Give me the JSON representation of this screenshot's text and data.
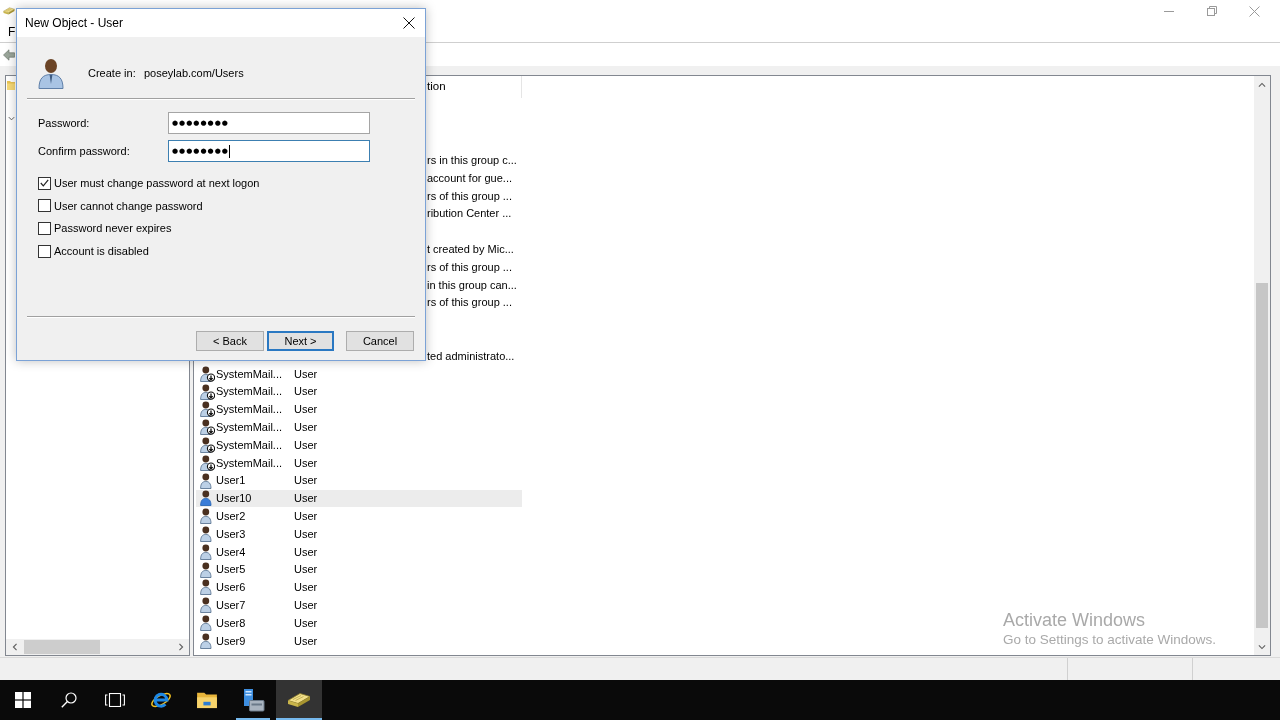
{
  "dialog": {
    "title": "New Object - User",
    "create_in": {
      "label": "Create in:",
      "value": "poseylab.com/Users"
    },
    "fields": [
      {
        "label": "Password:",
        "value": "●●●●●●●●",
        "focused": false
      },
      {
        "label": "Confirm password:",
        "value": "●●●●●●●●",
        "focused": true
      }
    ],
    "options": [
      {
        "label": "User must change password at next logon",
        "checked": true
      },
      {
        "label": "User cannot change password",
        "checked": false
      },
      {
        "label": "Password never expires",
        "checked": false
      },
      {
        "label": "Account is disabled",
        "checked": false
      }
    ],
    "buttons": [
      {
        "label": "< Back",
        "default": false
      },
      {
        "label": "Next >",
        "default": true
      },
      {
        "label": "Cancel",
        "default": false
      }
    ]
  },
  "app_window": {
    "menu": [
      "F"
    ],
    "tree": {
      "items": [
        {
          "expanded": true
        }
      ]
    }
  },
  "list": {
    "header": {
      "column_3": "tion"
    },
    "rows": [
      {},
      {},
      {},
      {
        "column_3": "rs in this group c..."
      },
      {
        "column_3": "account for gue..."
      },
      {
        "column_3": "rs of this group ..."
      },
      {
        "column_3": "ribution Center ..."
      },
      {},
      {
        "column_3": "t created by Mic..."
      },
      {
        "column_3": "rs of this group ..."
      },
      {
        "column_3": "in this group can..."
      },
      {
        "column_3": "rs of this group ..."
      },
      {},
      {},
      {
        "column_3": "ted administrato..."
      },
      {
        "column_1": "SystemMail...",
        "column_2": "User",
        "disabled": true,
        "selected": false
      },
      {
        "column_1": "SystemMail...",
        "column_2": "User",
        "disabled": true,
        "selected": false
      },
      {
        "column_1": "SystemMail...",
        "column_2": "User",
        "disabled": true,
        "selected": false
      },
      {
        "column_1": "SystemMail...",
        "column_2": "User",
        "disabled": true,
        "selected": false
      },
      {
        "column_1": "SystemMail...",
        "column_2": "User",
        "disabled": true,
        "selected": false
      },
      {
        "column_1": "SystemMail...",
        "column_2": "User",
        "disabled": true,
        "selected": false
      },
      {
        "column_1": "User1",
        "column_2": "User",
        "disabled": false,
        "selected": false
      },
      {
        "column_1": "User10",
        "column_2": "User",
        "disabled": false,
        "selected": true
      },
      {
        "column_1": "User2",
        "column_2": "User",
        "disabled": false,
        "selected": false
      },
      {
        "column_1": "User3",
        "column_2": "User",
        "disabled": false,
        "selected": false
      },
      {
        "column_1": "User4",
        "column_2": "User",
        "disabled": false,
        "selected": false
      },
      {
        "column_1": "User5",
        "column_2": "User",
        "disabled": false,
        "selected": false
      },
      {
        "column_1": "User6",
        "column_2": "User",
        "disabled": false,
        "selected": false
      },
      {
        "column_1": "User7",
        "column_2": "User",
        "disabled": false,
        "selected": false
      },
      {
        "column_1": "User8",
        "column_2": "User",
        "disabled": false,
        "selected": false
      },
      {
        "column_1": "User9",
        "column_2": "User",
        "disabled": false,
        "selected": false
      }
    ]
  },
  "activation_notice": {
    "title": "Activate Windows",
    "message": "Go to Settings to activate Windows."
  },
  "taskbar": {
    "buttons": [
      {
        "kind": "start"
      },
      {
        "kind": "search"
      },
      {
        "kind": "task_view"
      }
    ],
    "apps": [
      {
        "kind": "browser",
        "running": false,
        "active": false
      },
      {
        "kind": "folder",
        "running": false,
        "active": false
      },
      {
        "kind": "server",
        "running": true,
        "active": false
      },
      {
        "kind": "directory",
        "running": true,
        "active": true
      }
    ]
  }
}
